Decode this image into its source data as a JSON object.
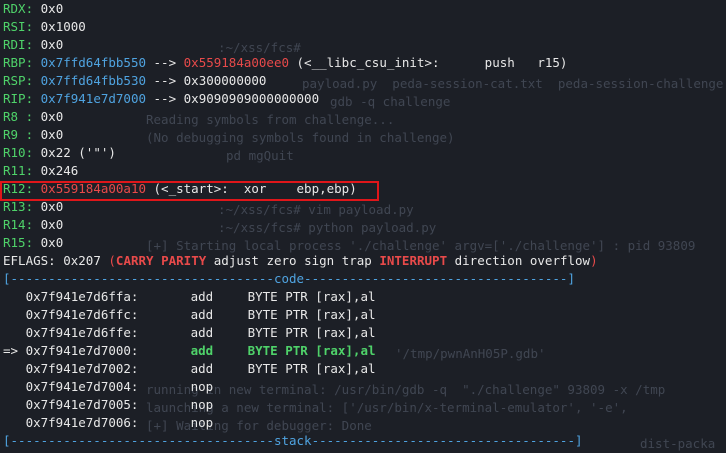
{
  "background_text": [
    {
      "text": ":~/xss/fcs#"
    },
    {
      "text": "payload.py  peda-session-cat.txt  peda-session-challenge"
    },
    {
      "text": "gdb -q challenge"
    },
    {
      "text": "Reading symbols from challenge..."
    },
    {
      "text": "(No debugging symbols found in challenge)"
    },
    {
      "text": "pd mgQuit"
    },
    {
      "text": ":~/xss/fcs# vim payload.py"
    },
    {
      "text": ":~/xss/fcs# python payload.py"
    },
    {
      "text": "[+] Starting local process './challenge' argv=['./challenge'] : pid 93809"
    },
    {
      "text": "'/tmp/pwnAnH05P.gdb'"
    },
    {
      "text": "running in new terminal: /usr/bin/gdb -q  \"./challenge\" 93809 -x /tmp"
    },
    {
      "text": "launching a new terminal: ['/usr/bin/x-terminal-emulator', '-e',"
    },
    {
      "text": "[+] Waiting for debugger: Done"
    },
    {
      "text": "dist-packa"
    }
  ],
  "registers": [
    {
      "name": "RDX",
      "value": "0x0"
    },
    {
      "name": "RSI",
      "value": "0x1000"
    },
    {
      "name": "RDI",
      "value": "0x0"
    },
    {
      "name": "RBP",
      "addr": "0x7ffd64fbb550",
      "arrow": "-->",
      "target": "0x559184a00ee0",
      "detail": "(<__libc_csu_init>:      push   r15)"
    },
    {
      "name": "RSP",
      "addr": "0x7ffd64fbb530",
      "arrow": "-->",
      "target": "0x300000000"
    },
    {
      "name": "RIP",
      "addr": "0x7f941e7d7000",
      "arrow": "-->",
      "target": "0x9090909000000000"
    },
    {
      "name": "R8 ",
      "value": "0x0"
    },
    {
      "name": "R9 ",
      "value": "0x0"
    },
    {
      "name": "R10",
      "value": "0x22 ('\"')"
    },
    {
      "name": "R11",
      "value": "0x246"
    },
    {
      "name": "R12",
      "addr": "0x559184a00a10",
      "detail": "(<_start>:  xor    ebp,ebp)"
    },
    {
      "name": "R13",
      "value": "0x0"
    },
    {
      "name": "R14",
      "value": "0x0"
    },
    {
      "name": "R15",
      "value": "0x0"
    }
  ],
  "eflags": {
    "label": "EFLAGS:",
    "value": "0x207",
    "open": "(",
    "flags_set": [
      "CARRY",
      "PARITY"
    ],
    "flags_mid": "adjust zero sign trap",
    "flag_interrupt": "INTERRUPT",
    "flags_end": "direction overflow",
    "close": ")"
  },
  "code_header": {
    "left": "[-----------------------------------",
    "label": "code",
    "right": "-----------------------------------]"
  },
  "code_lines": [
    {
      "marker": "   ",
      "addr": "0x7f941e7d6ffa:",
      "mnem": "add",
      "operands": "BYTE PTR [rax],al"
    },
    {
      "marker": "   ",
      "addr": "0x7f941e7d6ffc:",
      "mnem": "add",
      "operands": "BYTE PTR [rax],al"
    },
    {
      "marker": "   ",
      "addr": "0x7f941e7d6ffe:",
      "mnem": "add",
      "operands": "BYTE PTR [rax],al"
    },
    {
      "marker": "=> ",
      "addr": "0x7f941e7d7000:",
      "mnem": "add",
      "operands": "BYTE PTR [rax],al",
      "current": true
    },
    {
      "marker": "   ",
      "addr": "0x7f941e7d7002:",
      "mnem": "add",
      "operands": "BYTE PTR [rax],al"
    },
    {
      "marker": "   ",
      "addr": "0x7f941e7d7004:",
      "mnem": "nop",
      "operands": ""
    },
    {
      "marker": "   ",
      "addr": "0x7f941e7d7005:",
      "mnem": "nop",
      "operands": ""
    },
    {
      "marker": "   ",
      "addr": "0x7f941e7d7006:",
      "mnem": "nop",
      "operands": ""
    }
  ],
  "stack_header": {
    "left": "[-----------------------------------",
    "label": "stack",
    "right": "-----------------------------------]"
  },
  "colors": {
    "blue": "#4fa3e0",
    "red": "#e84a4a",
    "green": "#4fd36a",
    "highlight_box": "#e0161a"
  }
}
